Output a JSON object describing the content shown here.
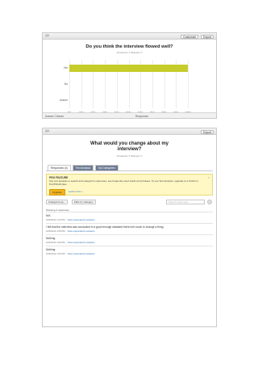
{
  "panel1": {
    "question_num": "Q3",
    "customize_label": "Customize",
    "export_label": "Export",
    "title": "Do you think the interview flowed well?",
    "subtitle": "Answered: 6    Skipped: 0",
    "footer_left": "Answer Choices",
    "footer_right": "Responses"
  },
  "chart_data": {
    "type": "bar",
    "orientation": "horizontal",
    "categories": [
      "Yes",
      "No",
      "Unsure"
    ],
    "values": [
      100,
      0,
      0
    ],
    "xlim": [
      0,
      100
    ],
    "ticks": [
      "0%",
      "10%",
      "20%",
      "30%",
      "40%",
      "50%",
      "60%",
      "70%",
      "80%",
      "90%",
      "100%"
    ],
    "colors": [
      "#c6cc2a"
    ],
    "grid": true
  },
  "panel2": {
    "question_num": "Q4",
    "export_label": "Export",
    "title": "What would you change about my interview?",
    "subtitle": "Answered: 6    Skipped: 0",
    "tabs": [
      "Responses (4)",
      "Text Analysis",
      "My Categories"
    ],
    "notice_title": "PRO FEATURE",
    "notice_text": "Use text analysis to search and categorize responses; see frequently used words and phrases. To use Text Analysis, upgrade to a GOLD or PLATINUM plan.",
    "upgrade_label": "Upgrade",
    "learn_more": "Learn more »",
    "filter_category": "Categorize as...",
    "filter_by": "Filter by Category",
    "search_placeholder": "Search responses",
    "showing": "Showing 4 responses",
    "responses": [
      {
        "text": "N/A",
        "date": "2/26/2014 1:19 PM",
        "link": "View respondent's answers"
      },
      {
        "text": "I felt that the interview was conducted in a good enough standard there isn't much to change a thing.",
        "date": "2/26/2014 1:08 PM",
        "link": "View respondent's answers"
      },
      {
        "text": "Nothing",
        "date": "2/26/2014 1:00 PM",
        "link": "View respondent's answers"
      },
      {
        "text": "Nothing",
        "date": "2/26/2014 1:00 PM",
        "link": "View respondent's answers"
      }
    ]
  }
}
